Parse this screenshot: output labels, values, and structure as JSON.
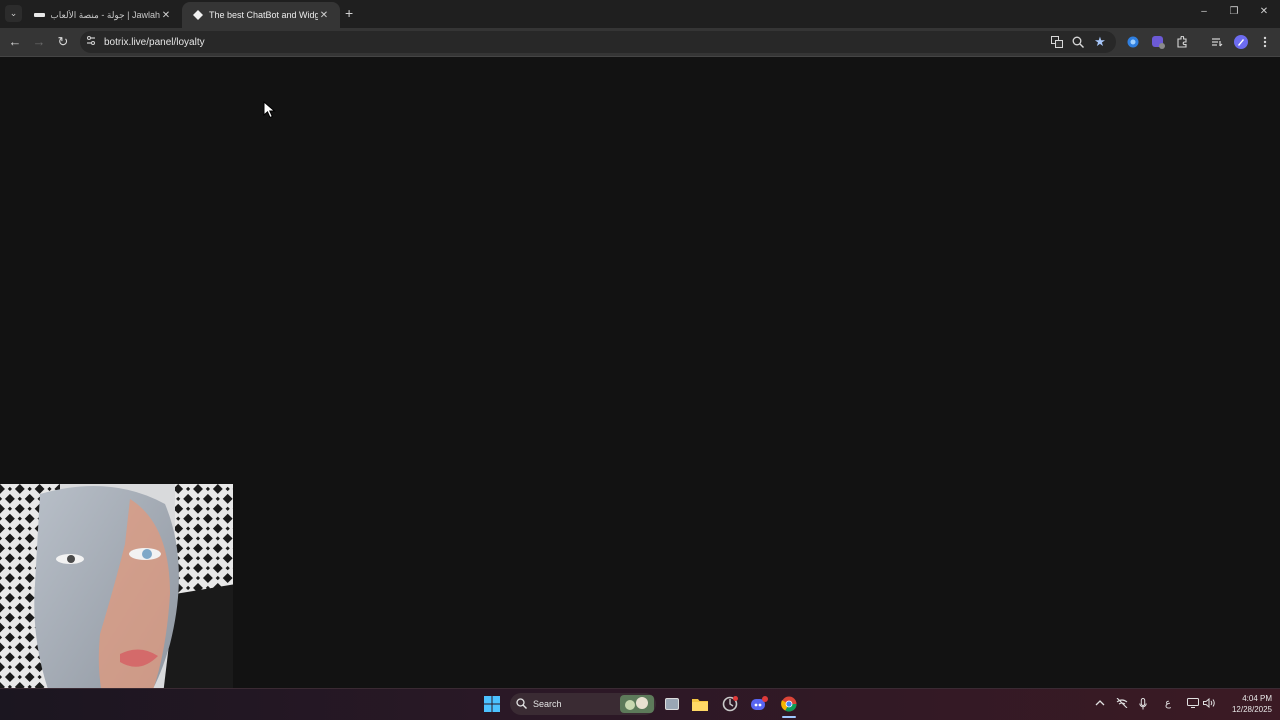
{
  "browser": {
    "tabs": [
      {
        "label": "Jawlah | جولة - منصة الألعاب الت",
        "favicon": "jawlah-favicon-icon",
        "active": false
      },
      {
        "label": "The best ChatBot and Widgets",
        "favicon": "botrix-favicon-icon",
        "active": true
      }
    ],
    "new_tab_symbol": "+",
    "close_symbol": "✕",
    "url": "botrix.live/panel/loyalty",
    "window_controls": {
      "minimize": "–",
      "maximize": "❐",
      "close": "✕"
    }
  },
  "toolbar_icons": [
    "translate-icon",
    "zoom-icon",
    "bookmark-star-icon",
    "extension-icon",
    "extension-icon",
    "extensions-puzzle-icon",
    "reading-list-icon",
    "profile-avatar-icon",
    "menu-icon"
  ],
  "colors": {
    "page_bg": "#121212",
    "tab_strip": "#1f1f1f",
    "toolbar": "#353535",
    "bookmark_star": "#a8c7fa"
  },
  "taskbar": {
    "search_placeholder": "Search",
    "apps": [
      "windows-start-icon",
      "search-icon",
      "task-view-icon",
      "file-explorer-icon",
      "app-icon",
      "discord-icon",
      "chrome-icon"
    ],
    "keyboard_layout": "ع",
    "time": "4:04 PM",
    "date": "12/28/2025"
  }
}
